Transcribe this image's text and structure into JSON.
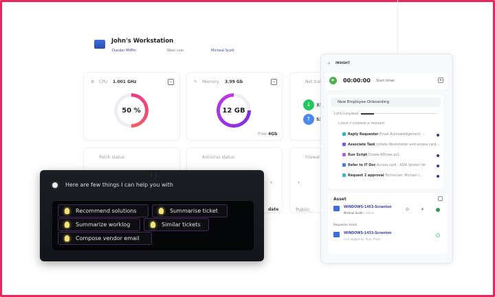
{
  "workstation": {
    "title": "John's Workstation",
    "company": "Dunder Mifflin",
    "location": "West cost",
    "user": "Micheal Scott"
  },
  "cpu": {
    "label": "CPU",
    "value": "1.001 GHz",
    "usage": "50 %",
    "percent": 50
  },
  "memory": {
    "label": "Memory",
    "value": "3.99 Gb",
    "used": "12 GB",
    "percent": 75,
    "free_label": "Free",
    "free_value": "4Gb"
  },
  "network": {
    "label": "Net traf",
    "down": "33",
    "up": "53"
  },
  "patch": {
    "label": "Patch status"
  },
  "antivirus": {
    "label": "Antivirus status",
    "status_suffix": "date"
  },
  "firewall": {
    "label": "Firewal",
    "value": "Public"
  },
  "assistant": {
    "greeting": "Here are few things I can help you with",
    "suggestions": [
      "Recommend solutions",
      "Summarise ticket",
      "Summarize worklog",
      "Similar tickets",
      "Compose vendor email"
    ]
  },
  "panel": {
    "search": "INSIGHT",
    "timer": "00:00:00",
    "timer_label": "Start timer",
    "workflow": {
      "title": "New Employee Onboarding",
      "progress": "1 of 6 Completed",
      "progress_fraction": 0.17,
      "tasks": [
        {
          "type": "",
          "text": "Check if runbook is relevant",
          "color": ""
        },
        {
          "type": "Reply Requester",
          "text": "Email Acknowledgement -...",
          "color": "#2bb3c9"
        },
        {
          "type": "Associate Task",
          "text": "Initiate Workstation and access card...",
          "color": "#7a5ce0"
        },
        {
          "type": "Run Script",
          "text": "Create-ADUser.ps1",
          "color": "#b65fd6"
        },
        {
          "type": "Refer to IT Doc",
          "text": "Access card - ASIA Vendor list",
          "color": "#4a78e0"
        },
        {
          "type": "Request 2 approval",
          "text": "Technician: Michael (...",
          "color": "#2bbfc0"
        }
      ]
    },
    "asset": {
      "title": "Asset",
      "name": "WINDOWS-1453-Scranton",
      "owner": "Micheal Scott",
      "status": "is Online",
      "requester_title": "Requester Asset",
      "requester_name": "WINDOWS-1433-Scranton",
      "requester_sub": "Last logged by: Ryan Plaza"
    }
  },
  "colors": {
    "frame": "#e8265e",
    "link": "#3b3fa8",
    "green": "#22c55e",
    "blue": "#4a8af0"
  }
}
